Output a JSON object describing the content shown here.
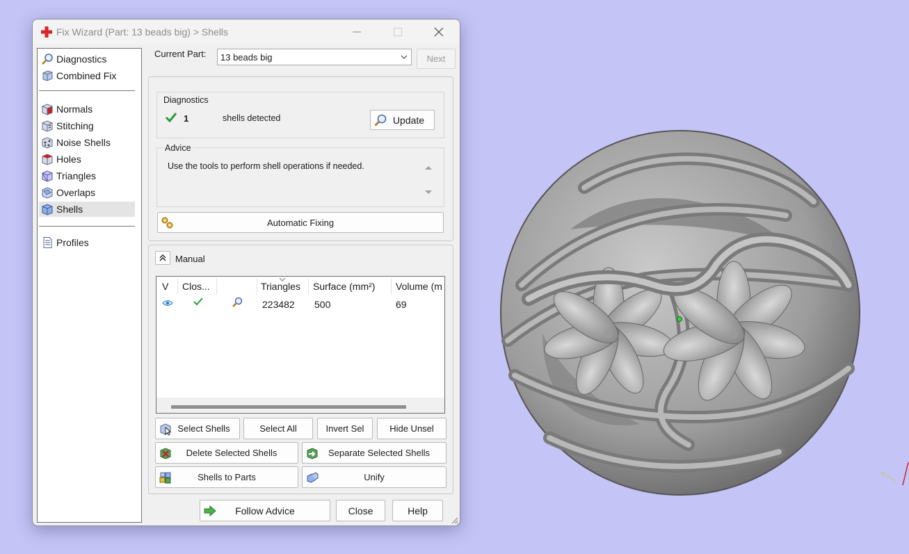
{
  "window": {
    "title": "Fix Wizard (Part: 13 beads big) > Shells",
    "minimize_icon": "minimize-icon",
    "maximize_icon": "maximize-icon",
    "close_icon": "close-icon"
  },
  "nav": {
    "group1": [
      {
        "label": "Diagnostics",
        "icon": "magnifier-icon"
      },
      {
        "label": "Combined Fix",
        "icon": "cube-icon"
      }
    ],
    "group2": [
      {
        "label": "Normals",
        "icon": "normals-icon"
      },
      {
        "label": "Stitching",
        "icon": "stitching-icon"
      },
      {
        "label": "Noise Shells",
        "icon": "noise-shells-icon"
      },
      {
        "label": "Holes",
        "icon": "holes-icon"
      },
      {
        "label": "Triangles",
        "icon": "triangles-icon"
      },
      {
        "label": "Overlaps",
        "icon": "overlaps-icon"
      },
      {
        "label": "Shells",
        "icon": "shells-icon",
        "selected": true
      }
    ],
    "group3": [
      {
        "label": "Profiles",
        "icon": "document-icon"
      }
    ]
  },
  "current_part": {
    "label": "Current Part:",
    "value": "13 beads big",
    "next_button": "Next"
  },
  "diagnostics": {
    "title": "Diagnostics",
    "count": "1",
    "text": "shells detected",
    "update_button": "Update"
  },
  "advice": {
    "title": "Advice",
    "text": "Use the tools to perform shell operations if needed."
  },
  "automatic_fixing_button": "Automatic Fixing",
  "manual": {
    "title": "Manual",
    "table": {
      "columns": [
        "V",
        "Clos...",
        "",
        "Triangles",
        "Surface (mm²)",
        "Volume (m"
      ],
      "rows": [
        {
          "visible_icon": "eye-icon",
          "closed_icon": "checkmark-icon",
          "action_icon": "magnifier-icon",
          "triangles": "223482",
          "surface": "500",
          "volume": "69"
        }
      ]
    },
    "buttons": {
      "select_shells": "Select Shells",
      "select_all": "Select All",
      "invert_sel": "Invert Sel",
      "hide_unsel": "Hide Unsel",
      "delete_selected_shells": "Delete Selected Shells",
      "separate_selected_shells": "Separate Selected Shells",
      "shells_to_parts": "Shells to Parts",
      "unify": "Unify"
    }
  },
  "footer": {
    "follow_advice": "Follow Advice",
    "close": "Close",
    "help": "Help"
  },
  "colors": {
    "viewport_background": "#c4c4f6",
    "check_green": "#2a9a3a",
    "model_gray": "#a9a9a9"
  }
}
